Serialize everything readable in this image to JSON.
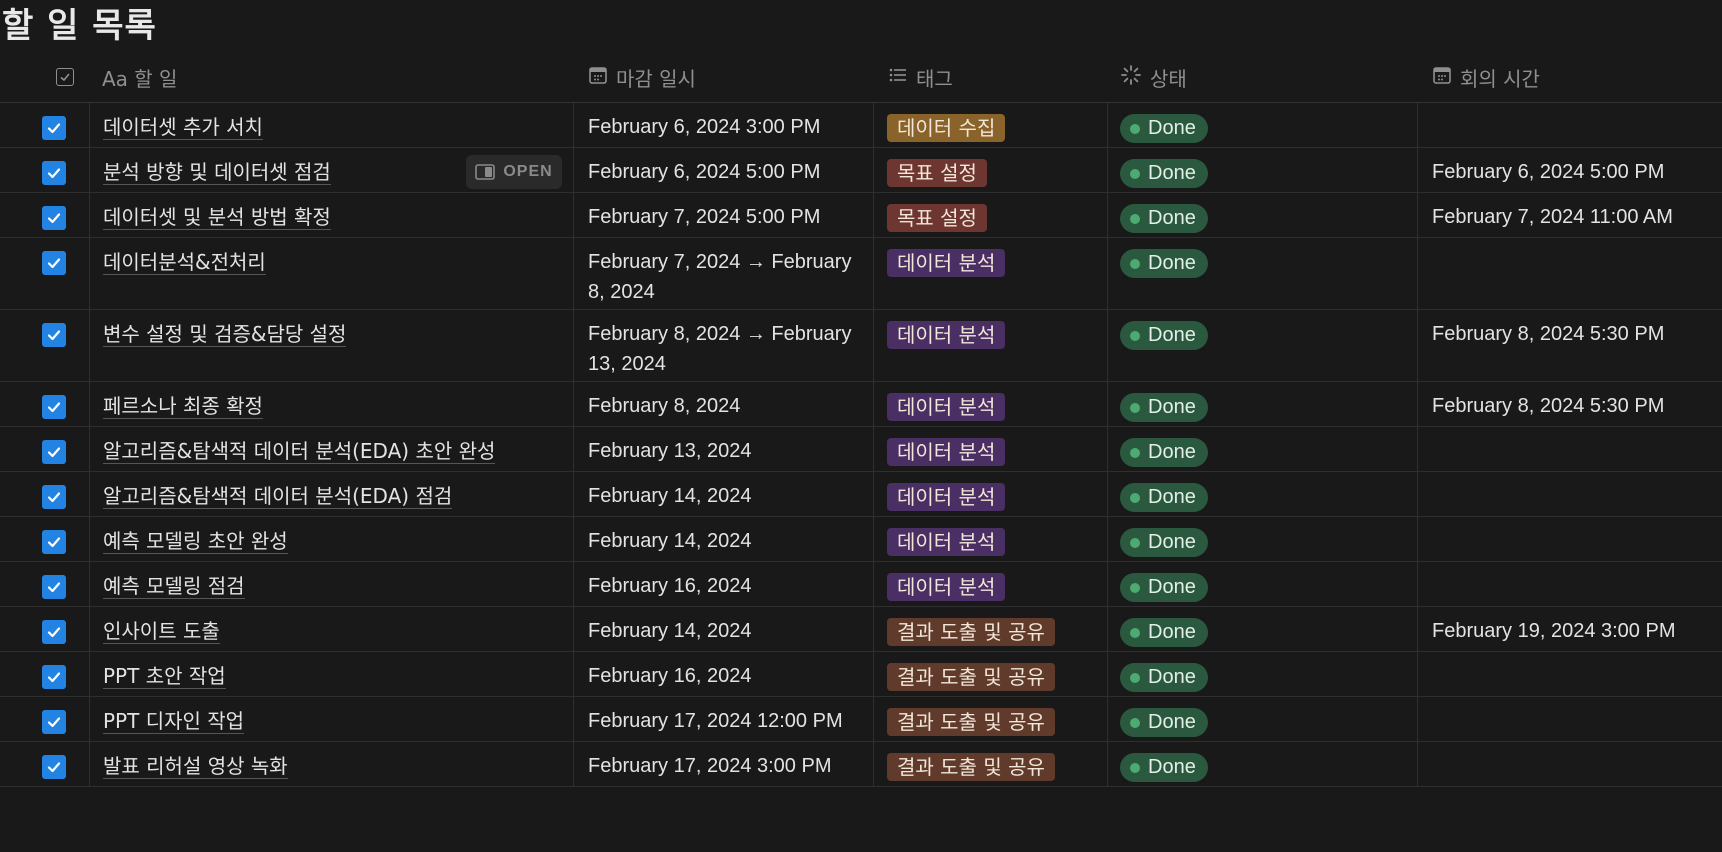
{
  "page_title": "할 일 목록",
  "columns": {
    "name": "Aa 할 일",
    "due": "마감 일시",
    "tags": "태그",
    "status": "상태",
    "meeting": "회의 시간"
  },
  "open_label": "OPEN",
  "tag_colors": {
    "데이터 수집": "#89632a",
    "목표 설정": "#6e3630",
    "데이터 분석": "#492f64",
    "결과 도출 및 공유": "#603b2c"
  },
  "rows": [
    {
      "name": "데이터셋 추가 서치",
      "due": "February 6, 2024 3:00 PM",
      "tag": "데이터 수집",
      "status": "Done",
      "meeting": ""
    },
    {
      "name": "분석 방향 및 데이터셋 점검",
      "due": "February 6, 2024 5:00 PM",
      "tag": "목표 설정",
      "status": "Done",
      "meeting": "February 6, 2024 5:00 PM"
    },
    {
      "name": "데이터셋 및 분석 방법 확정",
      "due": "February 7, 2024 5:00 PM",
      "tag": "목표 설정",
      "status": "Done",
      "meeting": "February 7, 2024 11:00 AM"
    },
    {
      "name": "데이터분석&전처리",
      "due": "February 7, 2024 → February 8, 2024",
      "tag": "데이터 분석",
      "status": "Done",
      "meeting": ""
    },
    {
      "name": "변수 설정 및 검증&담당 설정",
      "due": "February 8, 2024 → February 13, 2024",
      "tag": "데이터 분석",
      "status": "Done",
      "meeting": "February 8, 2024 5:30 PM"
    },
    {
      "name": "페르소나 최종 확정",
      "due": "February 8, 2024",
      "tag": "데이터 분석",
      "status": "Done",
      "meeting": "February 8, 2024 5:30 PM"
    },
    {
      "name": "알고리즘&탐색적 데이터 분석(EDA) 초안 완성",
      "due": "February 13, 2024",
      "tag": "데이터 분석",
      "status": "Done",
      "meeting": ""
    },
    {
      "name": "알고리즘&탐색적 데이터 분석(EDA) 점검",
      "due": "February 14, 2024",
      "tag": "데이터 분석",
      "status": "Done",
      "meeting": ""
    },
    {
      "name": "예측 모델링 초안 완성",
      "due": "February 14, 2024",
      "tag": "데이터 분석",
      "status": "Done",
      "meeting": ""
    },
    {
      "name": "예측 모델링 점검",
      "due": "February 16, 2024",
      "tag": "데이터 분석",
      "status": "Done",
      "meeting": ""
    },
    {
      "name": "인사이트 도출",
      "due": "February 14, 2024",
      "tag": "결과 도출 및 공유",
      "status": "Done",
      "meeting": "February 19, 2024 3:00 PM"
    },
    {
      "name": "PPT 초안 작업",
      "due": "February 16, 2024",
      "tag": "결과 도출 및 공유",
      "status": "Done",
      "meeting": ""
    },
    {
      "name": "PPT 디자인 작업",
      "due": "February 17, 2024 12:00 PM",
      "tag": "결과 도출 및 공유",
      "status": "Done",
      "meeting": ""
    },
    {
      "name": "발표 리허설 영상 녹화",
      "due": "February 17, 2024 3:00 PM",
      "tag": "결과 도출 및 공유",
      "status": "Done",
      "meeting": ""
    }
  ]
}
